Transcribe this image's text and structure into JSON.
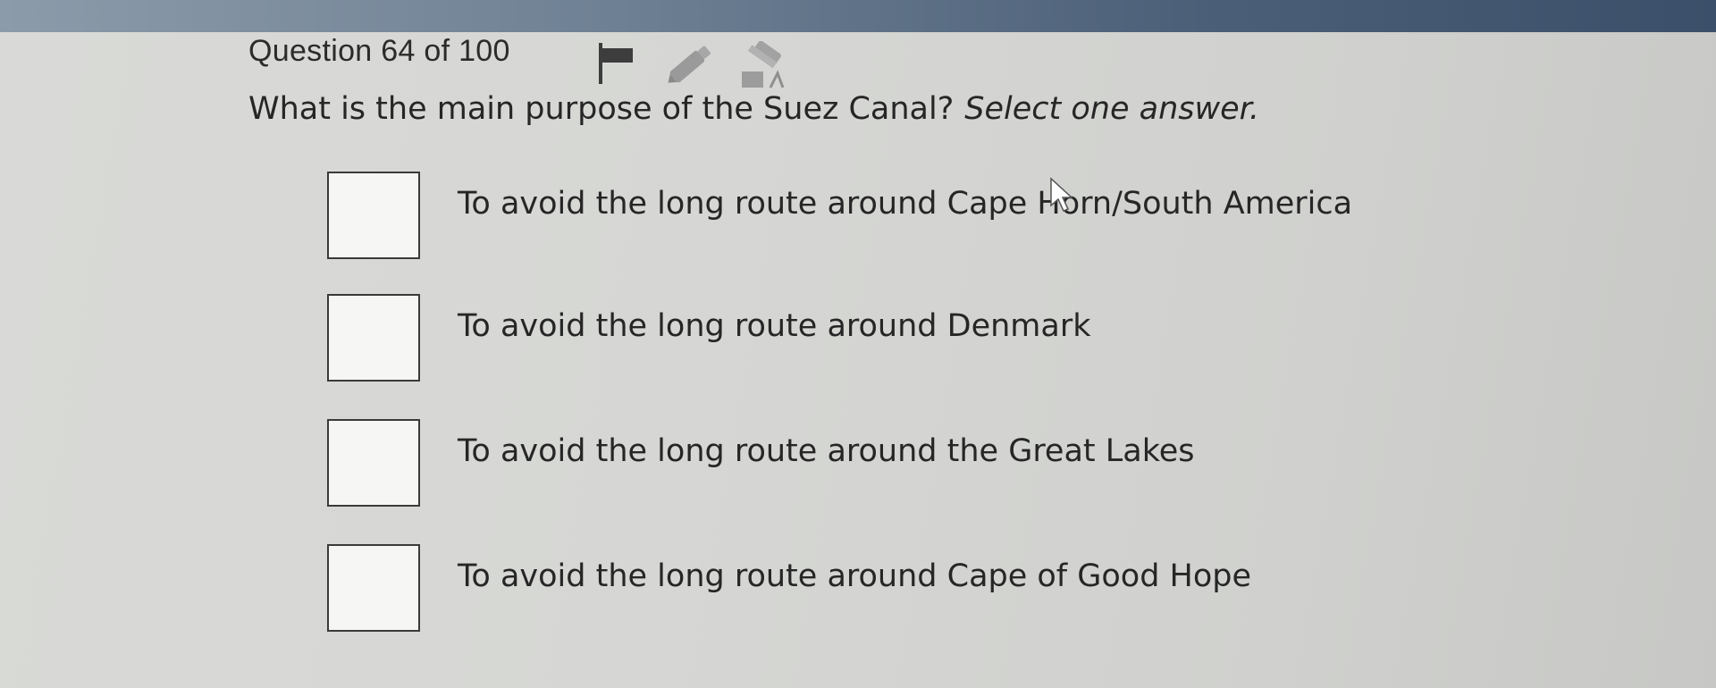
{
  "header": {
    "question_counter": "Question 64 of 100",
    "tools": [
      {
        "icon": "flag-icon"
      },
      {
        "icon": "highlighter-icon"
      },
      {
        "icon": "eraser-icon"
      }
    ]
  },
  "question": {
    "prompt": "What is the main purpose of the Suez Canal?",
    "instruction": "Select one answer."
  },
  "options": [
    {
      "label": "To avoid the long route around Cape Horn/South America",
      "checked": false
    },
    {
      "label": "To avoid the long route around Denmark",
      "checked": false
    },
    {
      "label": "To avoid the long route around the Great Lakes",
      "checked": false
    },
    {
      "label": "To avoid the long route around Cape of Good Hope",
      "checked": false
    }
  ],
  "colors": {
    "text": "#262626",
    "checkbox_border": "#3a3a3a",
    "header_bar": "#4b5f78"
  }
}
